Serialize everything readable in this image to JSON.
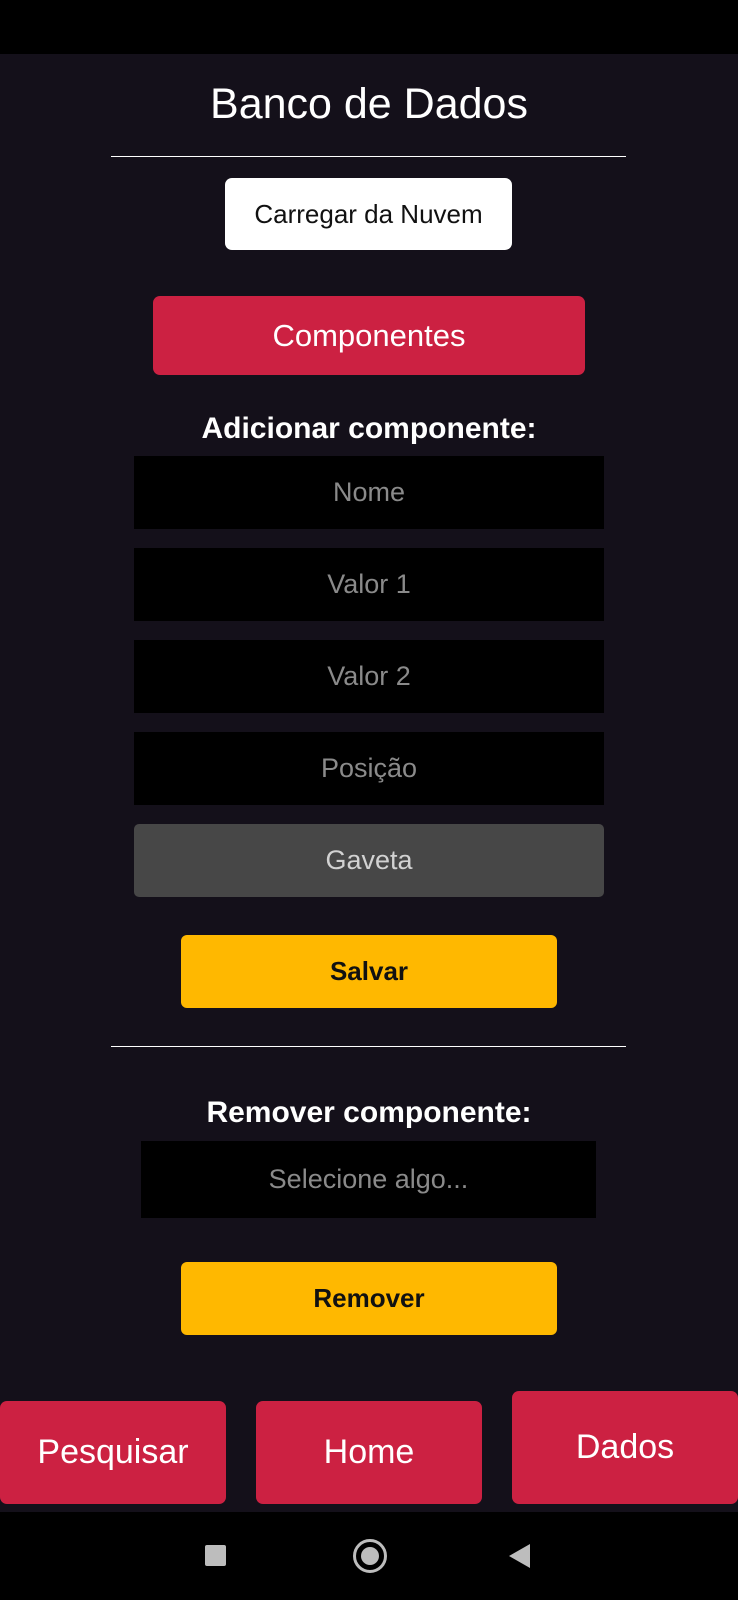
{
  "header": {
    "title": "Banco de Dados"
  },
  "cloud_button": {
    "label": "Carregar da Nuvem"
  },
  "section_button": {
    "label": "Componentes"
  },
  "add_form": {
    "heading": "Adicionar componente:",
    "name_placeholder": "Nome",
    "value1_placeholder": "Valor 1",
    "value2_placeholder": "Valor 2",
    "position_placeholder": "Posição",
    "drawer_label": "Gaveta",
    "save_label": "Salvar"
  },
  "remove_form": {
    "heading": "Remover componente:",
    "select_placeholder": "Selecione algo...",
    "remove_label": "Remover"
  },
  "bottom_nav": {
    "search": "Pesquisar",
    "home": "Home",
    "data": "Dados"
  },
  "system_nav": {
    "recents_icon": "square-icon",
    "home_icon": "circle-icon",
    "back_icon": "back-triangle-icon"
  },
  "colors": {
    "background": "#14101a",
    "accent_red": "#cc2142",
    "accent_yellow": "#ffb800",
    "input_bg": "#000000",
    "drawer_bg": "#474747"
  }
}
